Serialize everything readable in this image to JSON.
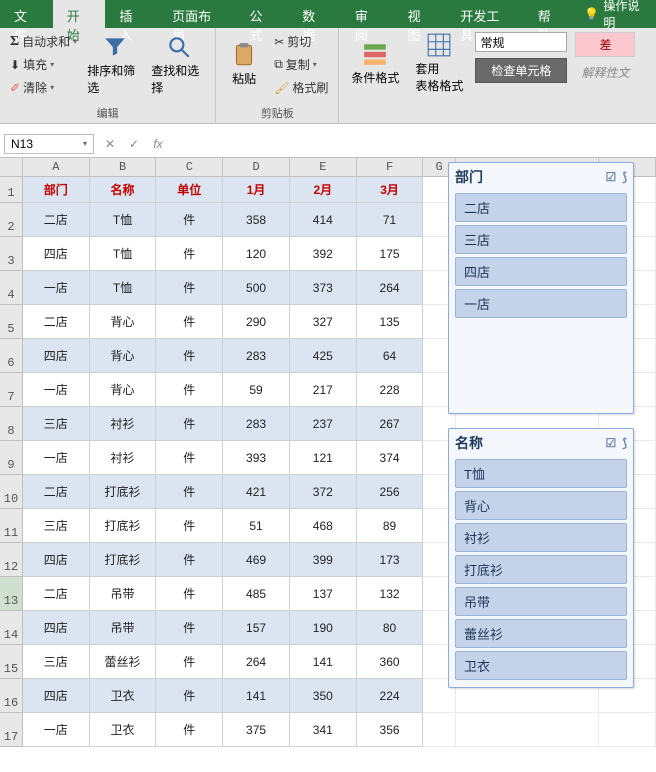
{
  "menu": {
    "file": "文件",
    "home": "开始",
    "insert": "插入",
    "layout": "页面布局",
    "formula": "公式",
    "data": "数据",
    "review": "审阅",
    "view": "视图",
    "dev": "开发工具",
    "help": "帮助",
    "hint": "操作说明"
  },
  "ribbon": {
    "autosum": "自动求和",
    "fill": "填充",
    "clear": "清除",
    "sortfilter": "排序和筛选",
    "findselect": "查找和选择",
    "paste": "粘贴",
    "cut": "剪切",
    "copy": "复制",
    "formatpainter": "格式刷",
    "condfmt": "条件格式",
    "tablefmt": "套用\n表格格式",
    "numfmt": "常规",
    "checkcell": "检查单元格",
    "bad": "差",
    "explanatory": "解释性文",
    "group_edit": "编辑",
    "group_clip": "剪贴板"
  },
  "namebox": "N13",
  "table": {
    "headers": [
      "部门",
      "名称",
      "单位",
      "1月",
      "2月",
      "3月"
    ],
    "rows": [
      [
        "二店",
        "T恤",
        "件",
        "358",
        "414",
        "71"
      ],
      [
        "四店",
        "T恤",
        "件",
        "120",
        "392",
        "175"
      ],
      [
        "一店",
        "T恤",
        "件",
        "500",
        "373",
        "264"
      ],
      [
        "二店",
        "背心",
        "件",
        "290",
        "327",
        "135"
      ],
      [
        "四店",
        "背心",
        "件",
        "283",
        "425",
        "64"
      ],
      [
        "一店",
        "背心",
        "件",
        "59",
        "217",
        "228"
      ],
      [
        "三店",
        "衬衫",
        "件",
        "283",
        "237",
        "267"
      ],
      [
        "一店",
        "衬衫",
        "件",
        "393",
        "121",
        "374"
      ],
      [
        "二店",
        "打底衫",
        "件",
        "421",
        "372",
        "256"
      ],
      [
        "三店",
        "打底衫",
        "件",
        "51",
        "468",
        "89"
      ],
      [
        "四店",
        "打底衫",
        "件",
        "469",
        "399",
        "173"
      ],
      [
        "二店",
        "吊带",
        "件",
        "485",
        "137",
        "132"
      ],
      [
        "四店",
        "吊带",
        "件",
        "157",
        "190",
        "80"
      ],
      [
        "三店",
        "蕾丝衫",
        "件",
        "264",
        "141",
        "360"
      ],
      [
        "四店",
        "卫衣",
        "件",
        "141",
        "350",
        "224"
      ],
      [
        "一店",
        "卫衣",
        "件",
        "375",
        "341",
        "356"
      ]
    ]
  },
  "slicer1": {
    "title": "部门",
    "items": [
      "二店",
      "三店",
      "四店",
      "一店"
    ]
  },
  "slicer2": {
    "title": "名称",
    "items": [
      "T恤",
      "背心",
      "衬衫",
      "打底衫",
      "吊带",
      "蕾丝衫",
      "卫衣"
    ]
  }
}
